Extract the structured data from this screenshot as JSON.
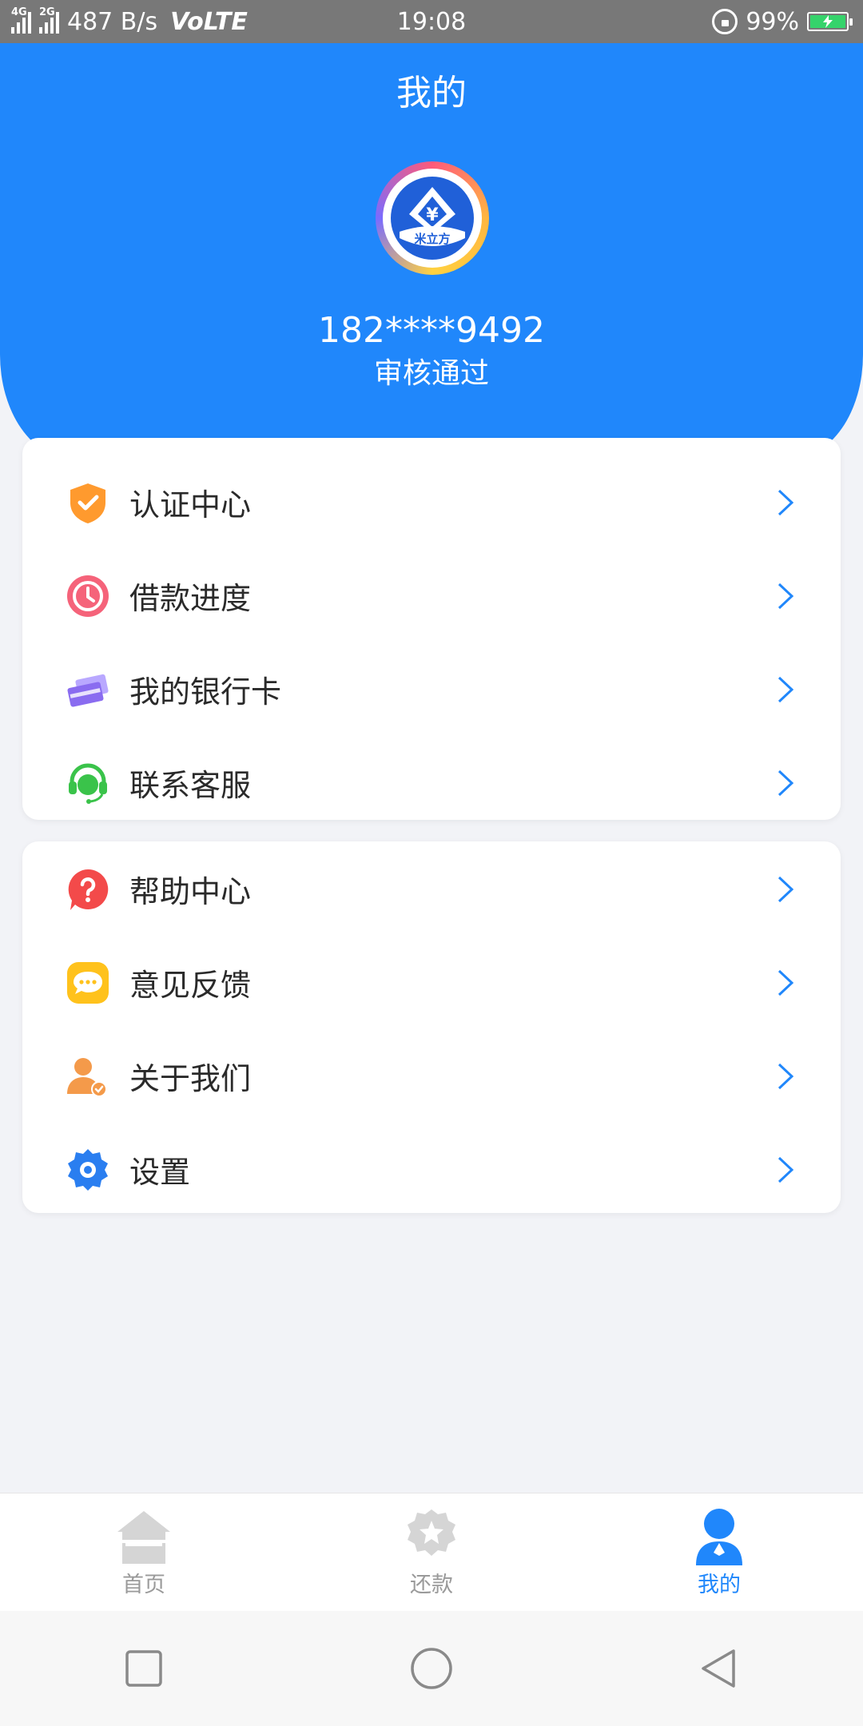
{
  "status_bar": {
    "sig1": "4G",
    "sig2": "2G",
    "net_speed": "487 B/s",
    "volte": "VoLTE",
    "time": "19:08",
    "battery": "99%"
  },
  "header": {
    "title": "我的",
    "phone": "182****9492",
    "status": "审核通过",
    "logo_text": "米立方",
    "logo_symbol": "¥"
  },
  "menu_group_1": [
    {
      "label": "认证中心",
      "icon": "shield-check-icon"
    },
    {
      "label": "借款进度",
      "icon": "clock-icon"
    },
    {
      "label": "我的银行卡",
      "icon": "bank-card-icon"
    },
    {
      "label": "联系客服",
      "icon": "headset-icon"
    }
  ],
  "menu_group_2": [
    {
      "label": "帮助中心",
      "icon": "help-icon"
    },
    {
      "label": "意见反馈",
      "icon": "chat-bubble-icon"
    },
    {
      "label": "关于我们",
      "icon": "user-badge-icon"
    },
    {
      "label": "设置",
      "icon": "gear-icon"
    }
  ],
  "bottom_nav": [
    {
      "label": "首页",
      "icon": "home-icon",
      "active": false
    },
    {
      "label": "还款",
      "icon": "repay-star-icon",
      "active": false
    },
    {
      "label": "我的",
      "icon": "user-icon",
      "active": true
    }
  ],
  "colors": {
    "primary": "#2087fb",
    "background": "#f2f3f7",
    "inactive": "#cfcfcf"
  }
}
